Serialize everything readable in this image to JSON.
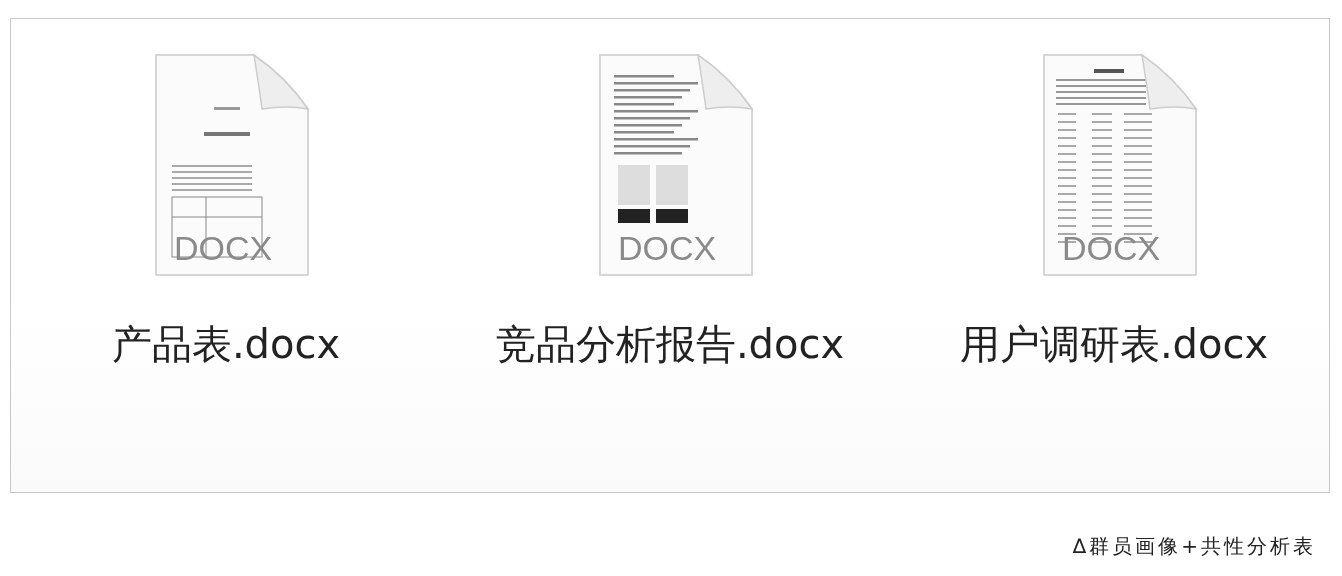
{
  "files": [
    {
      "name": "产品表.docx",
      "badge": "DOCX"
    },
    {
      "name": "竞品分析报告.docx",
      "badge": "DOCX"
    },
    {
      "name": "用户调研表.docx",
      "badge": "DOCX"
    }
  ],
  "caption": "∆群员画像+共性分析表"
}
